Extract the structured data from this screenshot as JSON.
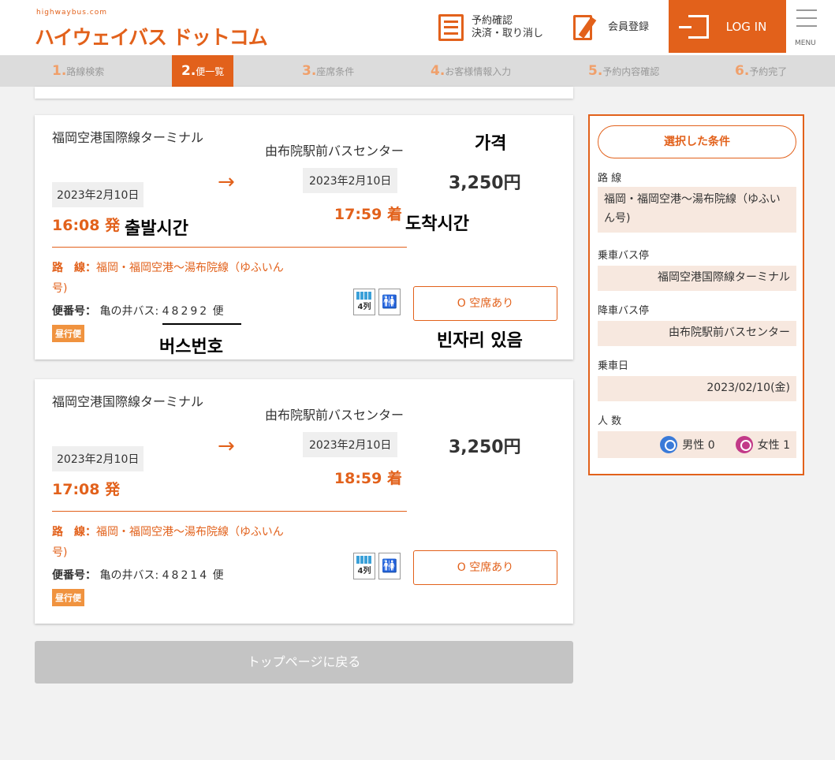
{
  "header": {
    "logo_sub": "highwaybus.com",
    "logo_main": "ハイウェイバス ドットコム",
    "reserve_line1": "予約確認",
    "reserve_line2": "決済・取り消し",
    "member": "会員登録",
    "login": "LOG IN",
    "menu": "MENU"
  },
  "steps": [
    {
      "num": "1.",
      "label": "路線検索"
    },
    {
      "num": "2.",
      "label": "便一覧"
    },
    {
      "num": "3.",
      "label": "座席条件"
    },
    {
      "num": "4.",
      "label": "お客様情報入力"
    },
    {
      "num": "5.",
      "label": "予約内容確認"
    },
    {
      "num": "6.",
      "label": "予約完了"
    }
  ],
  "results": [
    {
      "from_name": "福岡空港国際線ターミナル",
      "from_date": "2023年2月10日",
      "dep_time": "16:08 発",
      "to_name": "由布院駅前バスセンター",
      "to_date": "2023年2月10日",
      "arr_time": "17:59 着",
      "price": "3,250円",
      "route_label": "路　線：",
      "route": "福岡・福岡空港〜湯布院線（ゆふいん号)",
      "bus_label": "便番号：",
      "bus_company": "亀の井バス:",
      "bus_digits": "48292",
      "bus_suffix": "便",
      "badge": "昼行便",
      "seat_type": "4列",
      "availability": "O 空席あり"
    },
    {
      "from_name": "福岡空港国際線ターミナル",
      "from_date": "2023年2月10日",
      "dep_time": "17:08 発",
      "to_name": "由布院駅前バスセンター",
      "to_date": "2023年2月10日",
      "arr_time": "18:59 着",
      "price": "3,250円",
      "route_label": "路　線：",
      "route": "福岡・福岡空港〜湯布院線（ゆふいん号)",
      "bus_label": "便番号：",
      "bus_company": "亀の井バス:",
      "bus_digits": "48214",
      "bus_suffix": "便",
      "badge": "昼行便",
      "seat_type": "4列",
      "availability": "O 空席あり"
    }
  ],
  "back_button": "トップページに戻る",
  "sidebar": {
    "title": "選択した条件",
    "route_label": "路 線",
    "route_value": "福岡・福岡空港〜湯布院線（ゆふいん号)",
    "board_label": "乗車バス停",
    "board_value": "福岡空港国際線ターミナル",
    "alight_label": "降車バス停",
    "alight_value": "由布院駅前バスセンター",
    "date_label": "乗車日",
    "date_value": "2023/02/10(金)",
    "people_label": "人 数",
    "male": "男性 0",
    "female": "女性 1"
  },
  "annotations": {
    "price": "가격",
    "departure": "출발시간",
    "arrival": "도착시간",
    "bus_number": "버스번호",
    "seat": "빈자리 있음"
  },
  "colors": {
    "accent": "#e2611b",
    "badge": "#f0933f",
    "sidebar_value_bg": "#f7e8df"
  }
}
